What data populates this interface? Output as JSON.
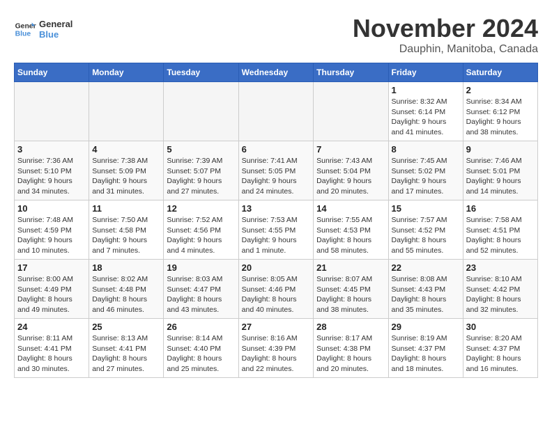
{
  "header": {
    "logo_text_general": "General",
    "logo_text_blue": "Blue",
    "month": "November 2024",
    "location": "Dauphin, Manitoba, Canada"
  },
  "weekdays": [
    "Sunday",
    "Monday",
    "Tuesday",
    "Wednesday",
    "Thursday",
    "Friday",
    "Saturday"
  ],
  "weeks": [
    [
      {
        "day": "",
        "info": ""
      },
      {
        "day": "",
        "info": ""
      },
      {
        "day": "",
        "info": ""
      },
      {
        "day": "",
        "info": ""
      },
      {
        "day": "",
        "info": ""
      },
      {
        "day": "1",
        "info": "Sunrise: 8:32 AM\nSunset: 6:14 PM\nDaylight: 9 hours\nand 41 minutes."
      },
      {
        "day": "2",
        "info": "Sunrise: 8:34 AM\nSunset: 6:12 PM\nDaylight: 9 hours\nand 38 minutes."
      }
    ],
    [
      {
        "day": "3",
        "info": "Sunrise: 7:36 AM\nSunset: 5:10 PM\nDaylight: 9 hours\nand 34 minutes."
      },
      {
        "day": "4",
        "info": "Sunrise: 7:38 AM\nSunset: 5:09 PM\nDaylight: 9 hours\nand 31 minutes."
      },
      {
        "day": "5",
        "info": "Sunrise: 7:39 AM\nSunset: 5:07 PM\nDaylight: 9 hours\nand 27 minutes."
      },
      {
        "day": "6",
        "info": "Sunrise: 7:41 AM\nSunset: 5:05 PM\nDaylight: 9 hours\nand 24 minutes."
      },
      {
        "day": "7",
        "info": "Sunrise: 7:43 AM\nSunset: 5:04 PM\nDaylight: 9 hours\nand 20 minutes."
      },
      {
        "day": "8",
        "info": "Sunrise: 7:45 AM\nSunset: 5:02 PM\nDaylight: 9 hours\nand 17 minutes."
      },
      {
        "day": "9",
        "info": "Sunrise: 7:46 AM\nSunset: 5:01 PM\nDaylight: 9 hours\nand 14 minutes."
      }
    ],
    [
      {
        "day": "10",
        "info": "Sunrise: 7:48 AM\nSunset: 4:59 PM\nDaylight: 9 hours\nand 10 minutes."
      },
      {
        "day": "11",
        "info": "Sunrise: 7:50 AM\nSunset: 4:58 PM\nDaylight: 9 hours\nand 7 minutes."
      },
      {
        "day": "12",
        "info": "Sunrise: 7:52 AM\nSunset: 4:56 PM\nDaylight: 9 hours\nand 4 minutes."
      },
      {
        "day": "13",
        "info": "Sunrise: 7:53 AM\nSunset: 4:55 PM\nDaylight: 9 hours\nand 1 minute."
      },
      {
        "day": "14",
        "info": "Sunrise: 7:55 AM\nSunset: 4:53 PM\nDaylight: 8 hours\nand 58 minutes."
      },
      {
        "day": "15",
        "info": "Sunrise: 7:57 AM\nSunset: 4:52 PM\nDaylight: 8 hours\nand 55 minutes."
      },
      {
        "day": "16",
        "info": "Sunrise: 7:58 AM\nSunset: 4:51 PM\nDaylight: 8 hours\nand 52 minutes."
      }
    ],
    [
      {
        "day": "17",
        "info": "Sunrise: 8:00 AM\nSunset: 4:49 PM\nDaylight: 8 hours\nand 49 minutes."
      },
      {
        "day": "18",
        "info": "Sunrise: 8:02 AM\nSunset: 4:48 PM\nDaylight: 8 hours\nand 46 minutes."
      },
      {
        "day": "19",
        "info": "Sunrise: 8:03 AM\nSunset: 4:47 PM\nDaylight: 8 hours\nand 43 minutes."
      },
      {
        "day": "20",
        "info": "Sunrise: 8:05 AM\nSunset: 4:46 PM\nDaylight: 8 hours\nand 40 minutes."
      },
      {
        "day": "21",
        "info": "Sunrise: 8:07 AM\nSunset: 4:45 PM\nDaylight: 8 hours\nand 38 minutes."
      },
      {
        "day": "22",
        "info": "Sunrise: 8:08 AM\nSunset: 4:43 PM\nDaylight: 8 hours\nand 35 minutes."
      },
      {
        "day": "23",
        "info": "Sunrise: 8:10 AM\nSunset: 4:42 PM\nDaylight: 8 hours\nand 32 minutes."
      }
    ],
    [
      {
        "day": "24",
        "info": "Sunrise: 8:11 AM\nSunset: 4:41 PM\nDaylight: 8 hours\nand 30 minutes."
      },
      {
        "day": "25",
        "info": "Sunrise: 8:13 AM\nSunset: 4:41 PM\nDaylight: 8 hours\nand 27 minutes."
      },
      {
        "day": "26",
        "info": "Sunrise: 8:14 AM\nSunset: 4:40 PM\nDaylight: 8 hours\nand 25 minutes."
      },
      {
        "day": "27",
        "info": "Sunrise: 8:16 AM\nSunset: 4:39 PM\nDaylight: 8 hours\nand 22 minutes."
      },
      {
        "day": "28",
        "info": "Sunrise: 8:17 AM\nSunset: 4:38 PM\nDaylight: 8 hours\nand 20 minutes."
      },
      {
        "day": "29",
        "info": "Sunrise: 8:19 AM\nSunset: 4:37 PM\nDaylight: 8 hours\nand 18 minutes."
      },
      {
        "day": "30",
        "info": "Sunrise: 8:20 AM\nSunset: 4:37 PM\nDaylight: 8 hours\nand 16 minutes."
      }
    ]
  ]
}
